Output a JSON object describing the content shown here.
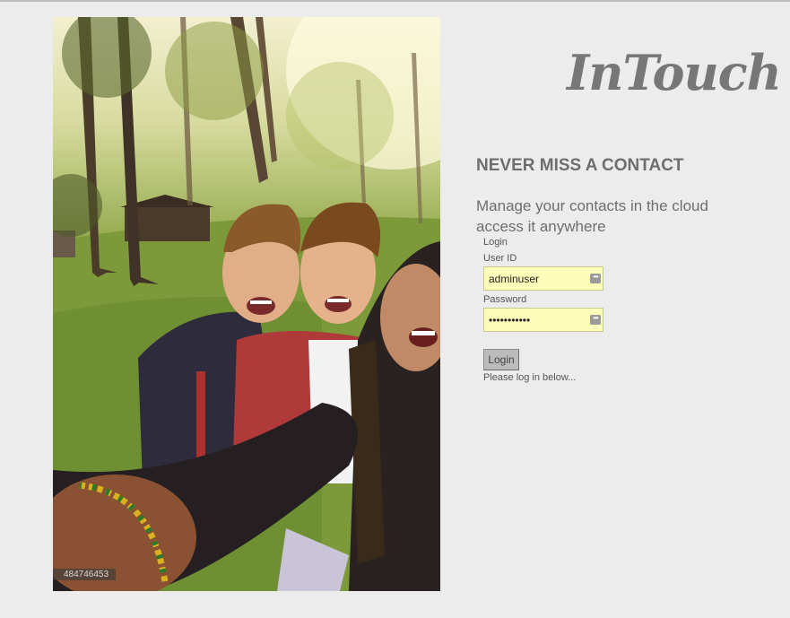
{
  "brand": {
    "logo_text": "InTouch"
  },
  "hero": {
    "image_id": "484746453"
  },
  "headline": "NEVER MISS A CONTACT",
  "tagline": "Manage your contacts in the cloud access it anywhere",
  "login": {
    "section_label": "Login",
    "user_label": "User ID",
    "user_value": "adminuser",
    "password_label": "Password",
    "password_value": "adminuser12",
    "button_label": "Login",
    "status_text": "Please log in below...",
    "autofill_icon": "more-dots-icon"
  },
  "colors": {
    "background": "#ececec",
    "text_gray": "#6e6e6e",
    "autofill_yellow": "#fdfdba"
  }
}
